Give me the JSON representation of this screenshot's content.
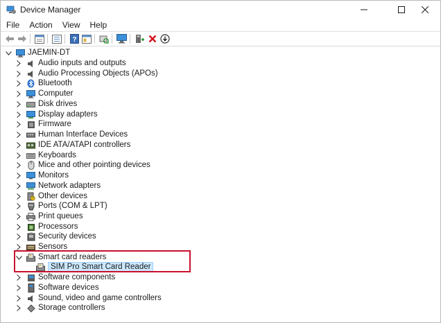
{
  "window": {
    "title": "Device Manager"
  },
  "menu": [
    "File",
    "Action",
    "View",
    "Help"
  ],
  "toolbar_icons": [
    "back-icon",
    "forward-icon",
    "properties-icon",
    "show-hide-icon",
    "help-icon",
    "details-icon",
    "scan-icon",
    "monitor-icon",
    "update-driver-icon",
    "uninstall-icon",
    "download-icon"
  ],
  "tree": {
    "root": "JAEMIN-DT",
    "categories": [
      {
        "label": "Audio inputs and outputs",
        "icon": "speaker-icon"
      },
      {
        "label": "Audio Processing Objects (APOs)",
        "icon": "speaker-icon"
      },
      {
        "label": "Bluetooth",
        "icon": "bluetooth-icon"
      },
      {
        "label": "Computer",
        "icon": "computer-icon"
      },
      {
        "label": "Disk drives",
        "icon": "disk-icon"
      },
      {
        "label": "Display adapters",
        "icon": "display-icon"
      },
      {
        "label": "Firmware",
        "icon": "firmware-icon"
      },
      {
        "label": "Human Interface Devices",
        "icon": "hid-icon"
      },
      {
        "label": "IDE ATA/ATAPI controllers",
        "icon": "ide-icon"
      },
      {
        "label": "Keyboards",
        "icon": "keyboard-icon"
      },
      {
        "label": "Mice and other pointing devices",
        "icon": "mouse-icon"
      },
      {
        "label": "Monitors",
        "icon": "monitor-icon"
      },
      {
        "label": "Network adapters",
        "icon": "network-icon"
      },
      {
        "label": "Other devices",
        "icon": "other-device-icon"
      },
      {
        "label": "Ports (COM & LPT)",
        "icon": "port-icon"
      },
      {
        "label": "Print queues",
        "icon": "printer-icon"
      },
      {
        "label": "Processors",
        "icon": "processor-icon"
      },
      {
        "label": "Security devices",
        "icon": "security-icon"
      },
      {
        "label": "Sensors",
        "icon": "sensor-icon"
      },
      {
        "label": "Smart card readers",
        "icon": "smartcard-reader-icon",
        "expanded": true,
        "children": [
          {
            "label": "SIM Pro Smart Card Reader",
            "icon": "smartcard-reader-icon",
            "selected": true
          }
        ]
      },
      {
        "label": "Software components",
        "icon": "software-component-icon"
      },
      {
        "label": "Software devices",
        "icon": "software-device-icon"
      },
      {
        "label": "Sound, video and game controllers",
        "icon": "sound-icon"
      },
      {
        "label": "Storage controllers",
        "icon": "storage-icon"
      }
    ]
  },
  "colors": {
    "highlight_box": "#c8102e",
    "selection_bg": "#cce8ff",
    "icon_blue": "#2b7fd4"
  }
}
